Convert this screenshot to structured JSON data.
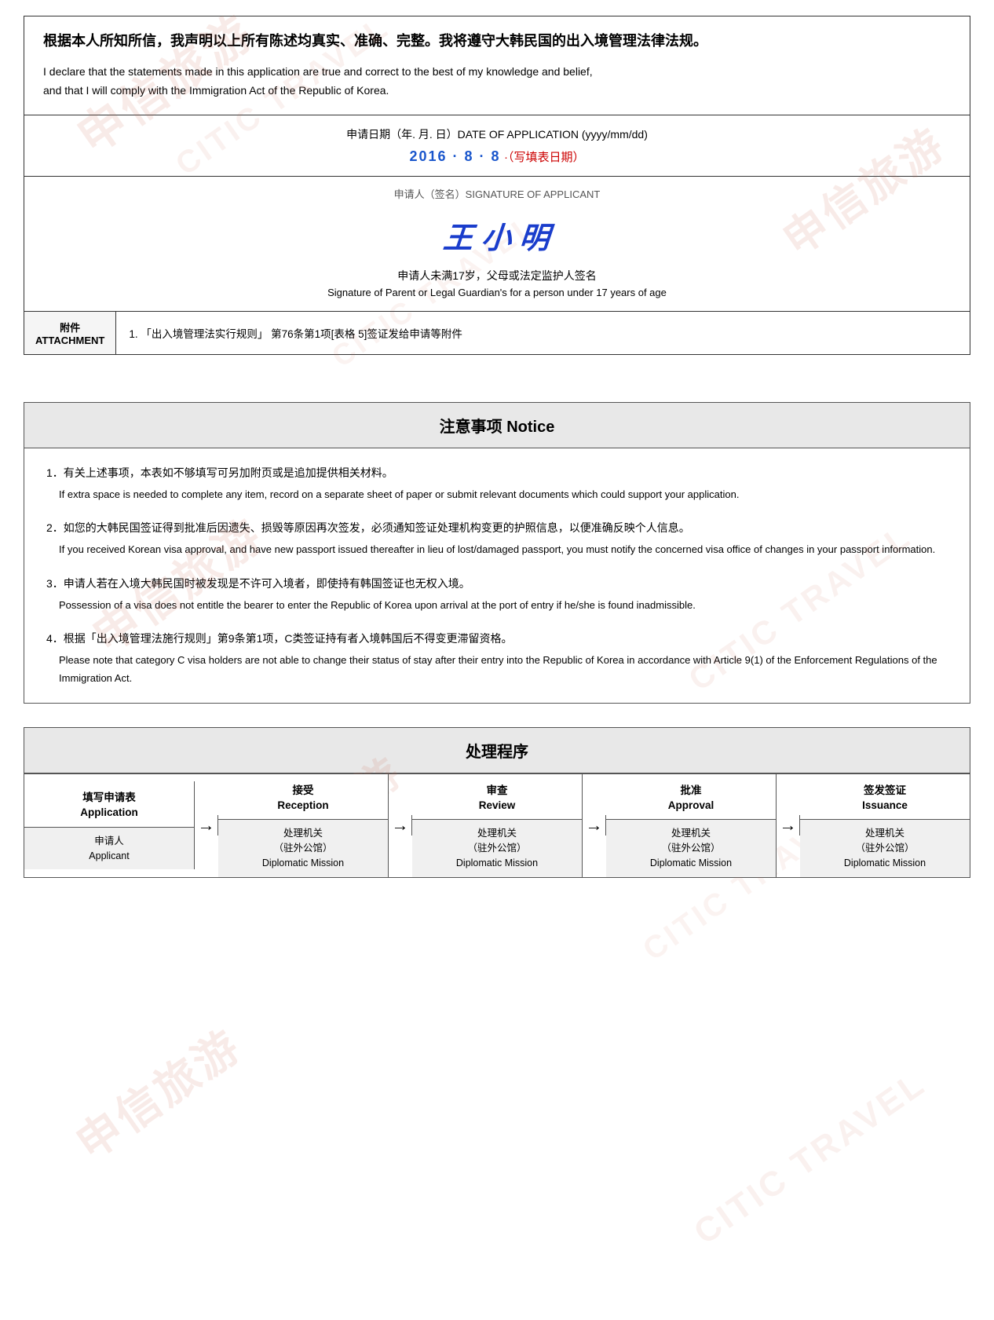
{
  "declaration": {
    "chinese": "根据本人所知所信，我声明以上所有陈述均真实、准确、完整。我将遵守大韩民国的出入境管理法律法规。",
    "english_line1": "I declare that the statements made in this application are true and correct to the best of my knowledge and belief,",
    "english_line2": "and that I will comply with the Immigration Act of the Republic of Korea."
  },
  "date": {
    "label": "申请日期（年. 月. 日）DATE OF APPLICATION (yyyy/mm/dd)",
    "value": "2016 ·  8  · 8",
    "note": "·（写填表日期）"
  },
  "signature": {
    "label_cn": "申请人（签名）SIGNATURE OF APPLICANT",
    "signature_text": "王 小 明",
    "guardian_cn": "申请人未满17岁，父母或法定监护人签名",
    "guardian_en": "Signature of Parent or Legal Guardian's for a person under 17 years of age"
  },
  "attachment": {
    "label_cn": "附件",
    "label_en": "ATTACHMENT",
    "item1": "1. 「出入境管理法实行规则」 第76条第1项[表格 5]签证发给申请等附件"
  },
  "notice": {
    "header": "注意事项  Notice",
    "items": [
      {
        "cn": "1．有关上述事项，本表如不够填写可另加附页或是追加提供相关材料。",
        "en": "If extra space is needed to complete any item, record on a separate sheet of paper or submit relevant documents which could support your application."
      },
      {
        "cn": "2．如您的大韩民国签证得到批准后因遗失、损毁等原因再次签发，必须通知签证处理机构变更的护照信息，以便准确反映个人信息。",
        "en": "If you received Korean visa approval, and have new passport issued thereafter in lieu of lost/damaged passport, you must notify the concerned visa office of changes in your passport information."
      },
      {
        "cn": "3．申请人若在入境大韩民国时被发现是不许可入境者，即使持有韩国签证也无权入境。",
        "en": "Possession of a visa does not entitle the bearer to enter the Republic of Korea upon arrival at the port of entry if he/she is found inadmissible."
      },
      {
        "cn": "4．根据「出入境管理法施行规则」第9条第1项，C类签证持有者入境韩国后不得变更滞留资格。",
        "en": "Please note that category C visa holders are not able to change their status of stay after their entry into the Republic of Korea in accordance with Article 9(1) of the Enforcement Regulations of the Immigration Act."
      }
    ]
  },
  "process": {
    "header": "处理程序",
    "steps": [
      {
        "top_cn": "填写申请表",
        "top_en": "Application",
        "bottom_cn": "申请人",
        "bottom_en": "Applicant"
      },
      {
        "top_cn": "接受",
        "top_en": "Reception",
        "bottom_cn": "处理机关\n（驻外公馆）",
        "bottom_en": "Diplomatic Mission"
      },
      {
        "top_cn": "审查",
        "top_en": "Review",
        "bottom_cn": "处理机关\n（驻外公馆）",
        "bottom_en": "Diplomatic Mission"
      },
      {
        "top_cn": "批准",
        "top_en": "Approval",
        "bottom_cn": "处理机关\n（驻外公馆）",
        "bottom_en": "Diplomatic Mission"
      },
      {
        "top_cn": "签发签证",
        "top_en": "Issuance",
        "bottom_cn": "处理机关\n（驻外公馆）",
        "bottom_en": "Diplomatic Mission"
      }
    ],
    "arrow": "→"
  },
  "watermark": {
    "text1": "申信旅游",
    "text2": "CITIC TRAVEL"
  }
}
